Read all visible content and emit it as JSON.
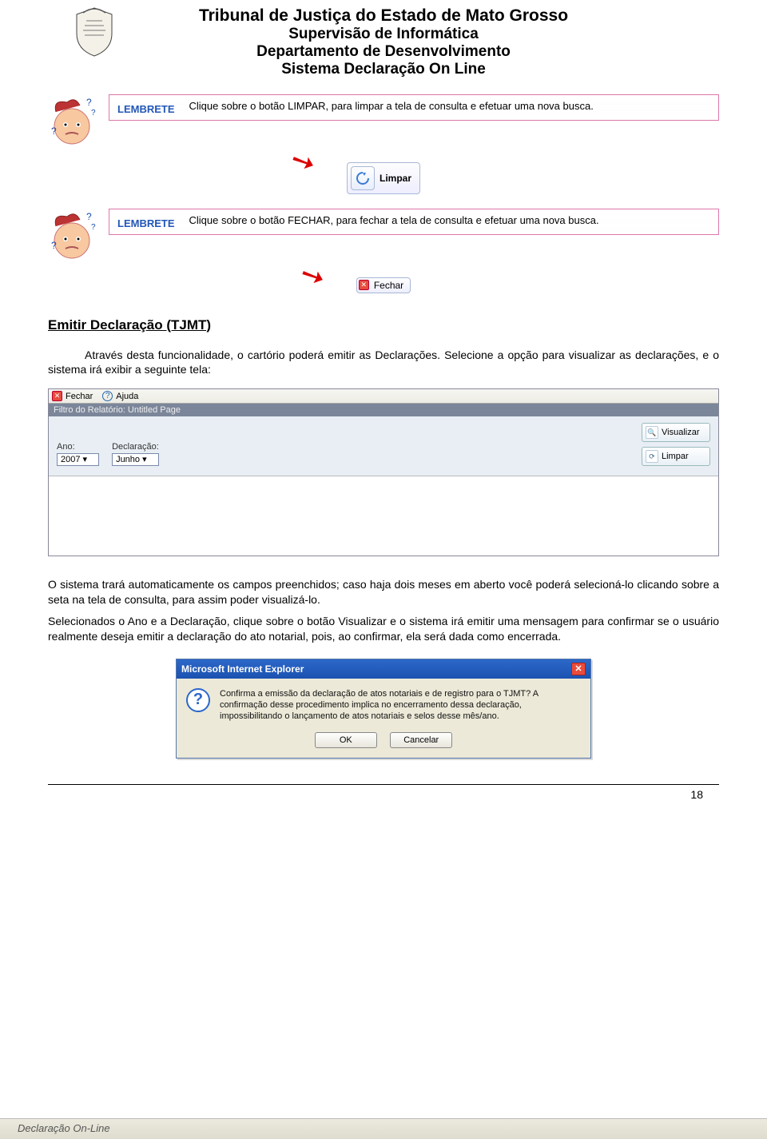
{
  "header": {
    "line1": "Tribunal de Justiça do Estado de Mato Grosso",
    "line2": "Supervisão de Informática",
    "line3": "Departamento de Desenvolvimento",
    "line4": "Sistema Declaração On Line"
  },
  "lembrete1": {
    "label": "LEMBRETE",
    "text": "Clique sobre o botão LIMPAR, para limpar a tela de consulta e efetuar uma nova busca.",
    "button_label": "Limpar"
  },
  "lembrete2": {
    "label": "LEMBRETE",
    "text": "Clique sobre o botão FECHAR, para fechar a tela de consulta e efetuar uma nova busca.",
    "button_label": "Fechar"
  },
  "section_title": "Emitir Declaração (TJMT)",
  "para1": "Através desta funcionalidade, o cartório poderá emitir as Declarações. Selecione a opção para visualizar as declarações, e o sistema irá exibir a seguinte tela:",
  "panel": {
    "close_label": "Fechar",
    "help_label": "Ajuda",
    "filter_label": "Filtro do Relatório: Untitled Page",
    "ano_label": "Ano:",
    "ano_value": "2007",
    "decl_label": "Declaração:",
    "decl_value": "Junho",
    "btn_vis": "Visualizar",
    "btn_limpar": "Limpar"
  },
  "para2": "O sistema trará automaticamente os campos preenchidos; caso haja dois meses em aberto você poderá selecioná-lo clicando sobre a seta na tela de consulta, para assim poder visualizá-lo.",
  "para3": "Selecionados o Ano e a Declaração, clique sobre o botão Visualizar e o sistema irá emitir uma mensagem para confirmar se o usuário realmente deseja emitir a declaração do ato notarial, pois, ao confirmar, ela será dada como encerrada.",
  "dialog": {
    "title": "Microsoft Internet Explorer",
    "message": "Confirma a emissão da declaração de atos notariais e de registro para o TJMT? A confirmação desse procedimento implica no encerramento dessa declaração, impossibilitando o lançamento de atos notariais e selos desse mês/ano.",
    "ok": "OK",
    "cancel": "Cancelar"
  },
  "page_number": "18",
  "footer": "Declaração On-Line"
}
